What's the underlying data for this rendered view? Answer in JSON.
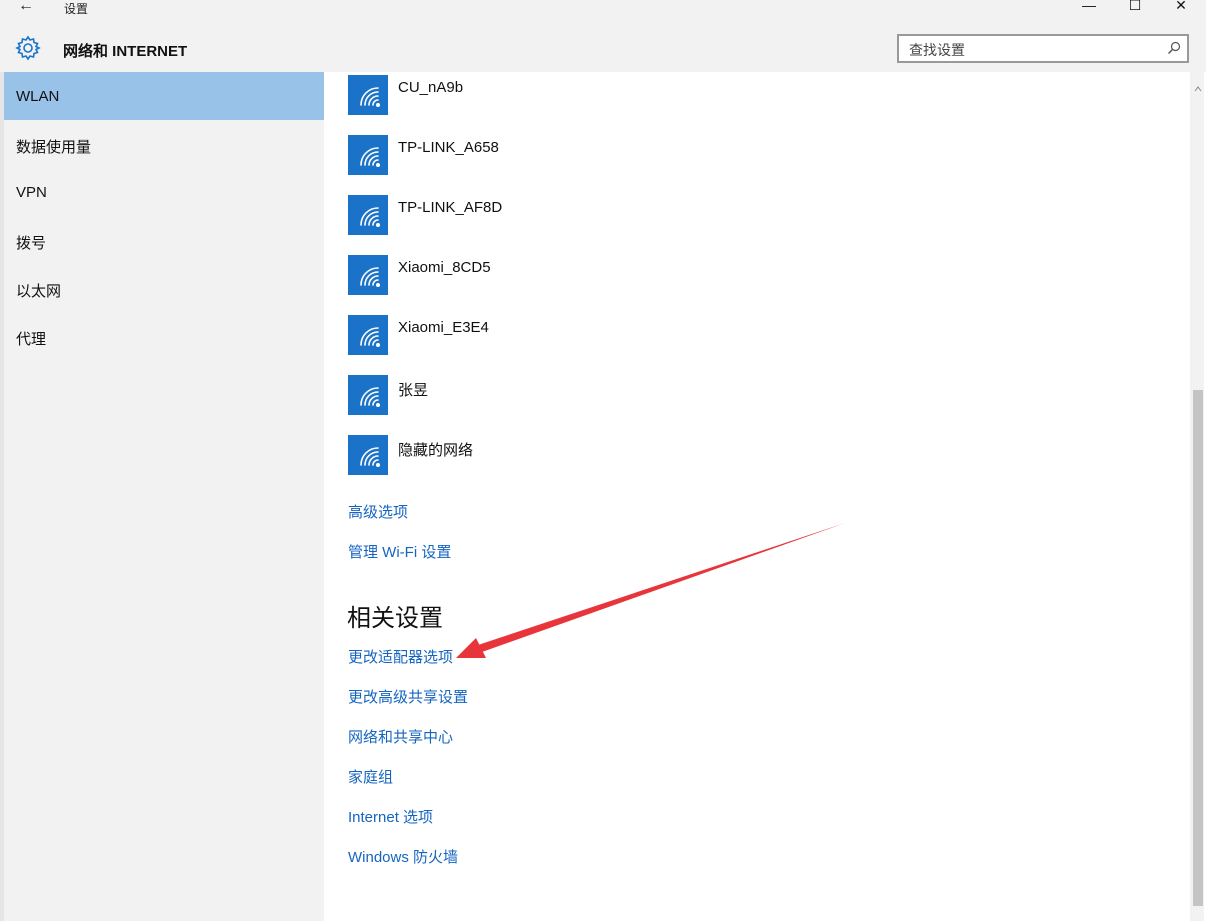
{
  "window": {
    "title": "设置",
    "back_glyph": "←",
    "minimize_glyph": "—",
    "maximize_glyph": "☐",
    "close_glyph": "✕"
  },
  "header": {
    "section_title": "网络和 INTERNET",
    "search_placeholder": "查找设置"
  },
  "sidebar": {
    "items": [
      {
        "label": "WLAN",
        "active": true
      },
      {
        "label": "数据使用量",
        "active": false
      },
      {
        "label": "VPN",
        "active": false
      },
      {
        "label": "拨号",
        "active": false
      },
      {
        "label": "以太网",
        "active": false
      },
      {
        "label": "代理",
        "active": false
      }
    ]
  },
  "networks": [
    {
      "name": "CU_nA9b",
      "icon": "wifi-icon"
    },
    {
      "name": "TP-LINK_A658",
      "icon": "wifi-icon"
    },
    {
      "name": "TP-LINK_AF8D",
      "icon": "wifi-icon"
    },
    {
      "name": "Xiaomi_8CD5",
      "icon": "wifi-icon"
    },
    {
      "name": "Xiaomi_E3E4",
      "icon": "wifi-icon"
    },
    {
      "name": "张昱",
      "icon": "wifi-icon"
    },
    {
      "name": "隐藏的网络",
      "icon": "wifi-icon"
    }
  ],
  "links": {
    "advanced_options": "高级选项",
    "manage_wifi": "管理 Wi-Fi 设置"
  },
  "related": {
    "title": "相关设置",
    "links": [
      "更改适配器选项",
      "更改高级共享设置",
      "网络和共享中心",
      "家庭组",
      "Internet 选项",
      "Windows 防火墙"
    ]
  },
  "colors": {
    "accent": "#1a73c8",
    "link": "#1565c0",
    "sidebar_active": "#99c2e8",
    "sidebar_bg": "#f2f2f2",
    "annotation_arrow": "#e8353b"
  }
}
